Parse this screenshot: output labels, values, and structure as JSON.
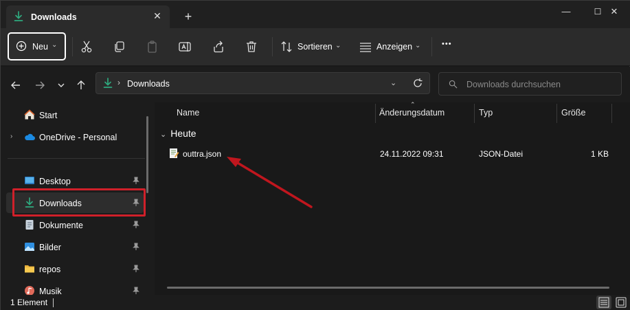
{
  "tab": {
    "title": "Downloads",
    "close_icon": "close-icon",
    "new_tab_icon": "plus-icon"
  },
  "window_controls": {
    "minimize": "—",
    "maximize": "☐",
    "close": "✕"
  },
  "toolbar": {
    "new_label": "Neu",
    "sort_label": "Sortieren",
    "view_label": "Anzeigen",
    "more_label": "•••"
  },
  "address": {
    "location": "Downloads"
  },
  "search": {
    "placeholder": "Downloads durchsuchen"
  },
  "sidebar": {
    "items": [
      {
        "label": "Start",
        "icon": "home-icon"
      },
      {
        "label": "OneDrive - Personal",
        "icon": "cloud-icon"
      },
      {
        "label": "Desktop",
        "icon": "desktop-icon"
      },
      {
        "label": "Downloads",
        "icon": "download-icon"
      },
      {
        "label": "Dokumente",
        "icon": "document-icon"
      },
      {
        "label": "Bilder",
        "icon": "picture-icon"
      },
      {
        "label": "repos",
        "icon": "folder-icon"
      },
      {
        "label": "Musik",
        "icon": "music-icon"
      }
    ]
  },
  "columns": {
    "name": "Name",
    "date": "Änderungsdatum",
    "type": "Typ",
    "size": "Größe"
  },
  "group": {
    "label": "Heute"
  },
  "files": [
    {
      "name": "outtra.json",
      "date": "24.11.2022 09:31",
      "type": "JSON-Datei",
      "size": "1 KB",
      "icon": "json-file-icon"
    }
  ],
  "status": {
    "count": "1 Element"
  },
  "colors": {
    "accent": "#2ea97e",
    "highlight_box": "#d0202a",
    "annotation_arrow": "#c0161e"
  }
}
